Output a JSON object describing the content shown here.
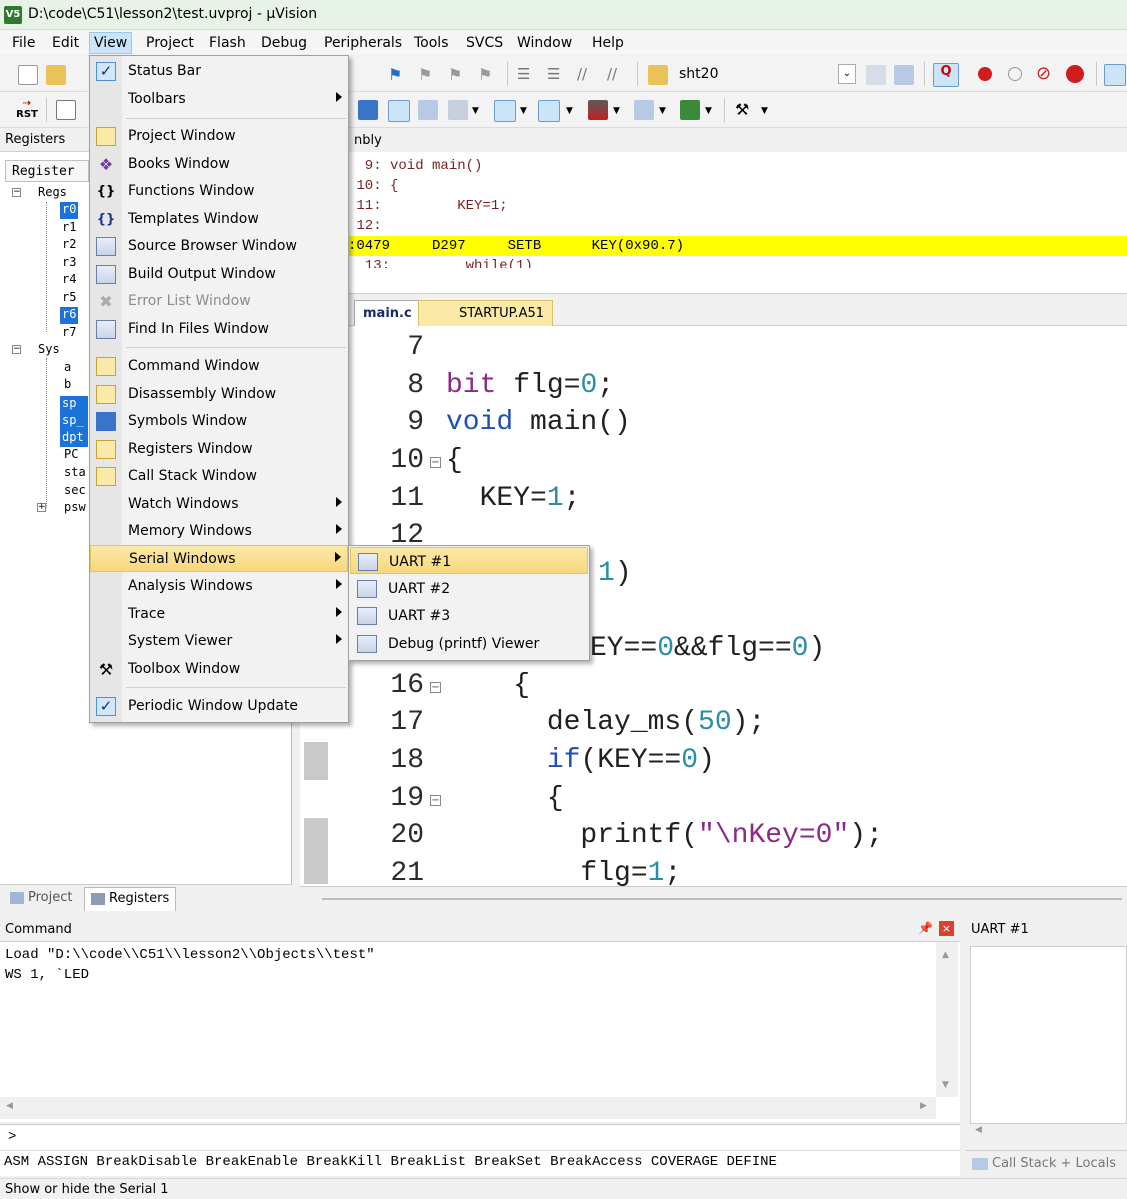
{
  "window": {
    "title": "D:\\code\\C51\\lesson2\\test.uvproj - µVision",
    "icon": "V5"
  },
  "menubar": [
    "File",
    "Edit",
    "View",
    "Project",
    "Flash",
    "Debug",
    "Peripherals",
    "Tools",
    "SVCS",
    "Window",
    "Help"
  ],
  "toolbar": {
    "target_name": "sht20",
    "rst_label": "RST"
  },
  "registers_panel": {
    "title": "Registers",
    "column": "Register",
    "groups": [
      {
        "name": "Regs",
        "items": [
          "r0",
          "r1",
          "r2",
          "r3",
          "r4",
          "r5",
          "r6",
          "r7"
        ]
      },
      {
        "name": "Sys",
        "items": [
          "a",
          "b",
          "sp",
          "sp_",
          "dpt",
          "PC",
          "sta",
          "sec",
          "psw"
        ]
      }
    ],
    "tabs": [
      "Project",
      "Registers"
    ]
  },
  "disassembly": {
    "title": "nbly",
    "lines": [
      "  9: void main()",
      " 10: {",
      " 11:         KEY=1;",
      " 12:",
      ":0479     D297     SETB      KEY(0x90.7)",
      "  13:         while(1)"
    ]
  },
  "editor": {
    "tabs": [
      "main.c",
      "STARTUP.A51"
    ],
    "line_numbers": [
      "7",
      "8",
      "9",
      "10",
      "11",
      "12",
      "",
      "",
      "",
      "16",
      "17",
      "18",
      "19",
      "20",
      "21"
    ],
    "code": {
      "l8_kw": "bit",
      "l8_rest": " flg=",
      "l8_num": "0",
      "l8_end": ";",
      "l9_kw": "void",
      "l9_rest": " main()",
      "l10": "{",
      "l11_a": "  KEY=",
      "l11_num": "1",
      "l11_end": ";",
      "l13_num": "1",
      "l13_end": ")",
      "l15_a": "EY==",
      "l15_n1": "0",
      "l15_b": "&&flg==",
      "l15_n2": "0",
      "l15_end": ")",
      "l16": "    {",
      "l17_a": "      delay_ms(",
      "l17_num": "50",
      "l17_end": ");",
      "l18_kw": "      if",
      "l18_a": "(KEY==",
      "l18_num": "0",
      "l18_end": ")",
      "l19": "      {",
      "l20_a": "        printf(",
      "l20_str": "\"\\nKey=0\"",
      "l20_end": ");",
      "l21_a": "        flg=",
      "l21_num": "1",
      "l21_end": ";"
    }
  },
  "command": {
    "title": "Command",
    "lines": [
      "Load \"D:\\\\code\\\\C51\\\\lesson2\\\\Objects\\\\test\"",
      "WS 1, `LED"
    ],
    "prompt": ">",
    "keywords": "ASM ASSIGN BreakDisable BreakEnable BreakKill BreakList BreakSet BreakAccess COVERAGE DEFINE"
  },
  "uart_panel": {
    "title": "UART #1",
    "tab": "Call Stack + Locals"
  },
  "statusbar": "Show or hide the Serial 1",
  "view_menu": [
    {
      "label": "Status Bar",
      "icon": "check-icon",
      "checked": true
    },
    {
      "label": "Toolbars",
      "submenu": true
    },
    {
      "label": "Project Window",
      "icon": "project-window-icon"
    },
    {
      "label": "Books Window",
      "icon": "books-icon"
    },
    {
      "label": "Functions Window",
      "icon": "braces-icon"
    },
    {
      "label": "Templates Window",
      "icon": "templates-icon"
    },
    {
      "label": "Source Browser Window",
      "icon": "source-browser-icon"
    },
    {
      "label": "Build Output Window",
      "icon": "build-output-icon"
    },
    {
      "label": "Error List Window",
      "icon": "error-list-icon",
      "disabled": true
    },
    {
      "label": "Find In Files Window",
      "icon": "find-in-files-icon"
    },
    {
      "label": "Command Window",
      "icon": "command-window-icon"
    },
    {
      "label": "Disassembly Window",
      "icon": "disassembly-icon"
    },
    {
      "label": "Symbols Window",
      "icon": "symbols-icon"
    },
    {
      "label": "Registers Window",
      "icon": "registers-icon"
    },
    {
      "label": "Call Stack Window",
      "icon": "call-stack-icon"
    },
    {
      "label": "Watch Windows",
      "submenu": true
    },
    {
      "label": "Memory Windows",
      "submenu": true
    },
    {
      "label": "Serial Windows",
      "submenu": true,
      "highlighted": true
    },
    {
      "label": "Analysis Windows",
      "submenu": true
    },
    {
      "label": "Trace",
      "submenu": true
    },
    {
      "label": "System Viewer",
      "submenu": true
    },
    {
      "label": "Toolbox Window",
      "icon": "toolbox-icon"
    },
    {
      "label": "Periodic Window Update",
      "icon": "check-icon",
      "checked": true
    }
  ],
  "serial_submenu": [
    {
      "label": "UART #1",
      "highlighted": true
    },
    {
      "label": "UART #2"
    },
    {
      "label": "UART #3"
    },
    {
      "label": "Debug (printf) Viewer"
    }
  ],
  "colors": {
    "highlight_line": "#ffff00",
    "selection": "#1a73d8",
    "menu_highlight": "#f7d77c",
    "keyword": "#8a2b8a",
    "number": "#2a8fa5"
  }
}
